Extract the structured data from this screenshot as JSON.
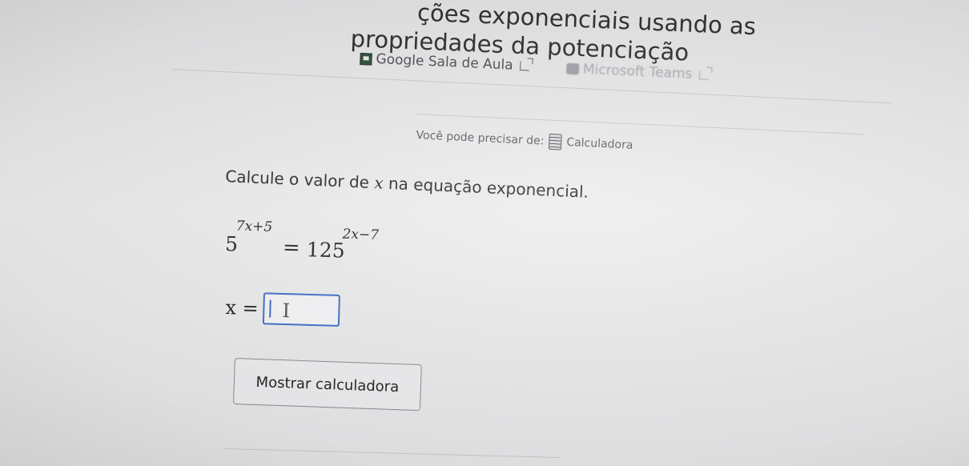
{
  "header": {
    "title_line1": "ções exponenciais usando as",
    "title_line2": "propriedades da potenciação"
  },
  "share_links": {
    "google_classroom": "Google Sala de Aula",
    "microsoft_teams": "Microsoft Teams"
  },
  "tools_hint": {
    "prefix": "Você pode precisar de:",
    "tool": "Calculadora"
  },
  "question": {
    "prompt_before": "Calcule o valor de",
    "variable": "x",
    "prompt_after": "na equação exponencial.",
    "left_base": "5",
    "left_exponent": "7x+5",
    "equals": "=",
    "right_base": "125",
    "right_exponent": "2x−7"
  },
  "answer": {
    "label": "x =",
    "value": ""
  },
  "buttons": {
    "show_calculator": "Mostrar calculadora"
  }
}
